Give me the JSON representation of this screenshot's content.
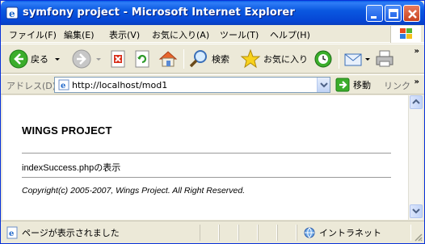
{
  "window": {
    "title": "symfony project - Microsoft Internet Explorer"
  },
  "menu": [
    "ファイル(F)",
    "編集(E)",
    "表示(V)",
    "お気に入り(A)",
    "ツール(T)",
    "ヘルプ(H)"
  ],
  "toolbar": {
    "back_label": "戻る",
    "search_label": "検索",
    "favorites_label": "お気に入り"
  },
  "address": {
    "label": "アドレス(D)",
    "url": "http://localhost/mod1",
    "go_label": "移動",
    "links_label": "リンク"
  },
  "page": {
    "heading": "WINGS PROJECT",
    "body_text": "indexSuccess.phpの表示",
    "footer": "Copyright(c) 2005-2007, Wings Project. All Right Reserved."
  },
  "status": {
    "text": "ページが表示されました",
    "zone": "イントラネット"
  },
  "colors": {
    "titlebar": "#0a58e0",
    "chrome": "#ece9d8"
  }
}
